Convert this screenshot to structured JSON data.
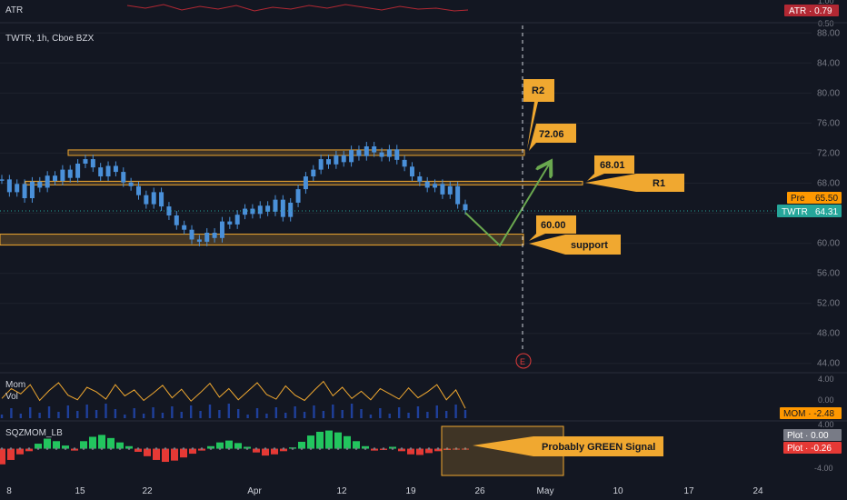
{
  "header": {
    "symbol_label": "TWTR, 1h, Cboe BZX",
    "atr_label": "ATR"
  },
  "badges": {
    "atr": "ATR · 0.79",
    "pre": "Pre",
    "pre_value": "65.50",
    "ticker": "TWTR",
    "ticker_value": "64.31",
    "mom": "MOM · -2.48",
    "plot1": "Plot · 0.00",
    "plot2": "Plot · -0.26"
  },
  "annotations": {
    "r2": "R2",
    "r2_value": "72.06",
    "r1": "R1",
    "r1_value": "68.01",
    "support": "support",
    "support_value": "60.00",
    "signal": "Probably GREEN Signal",
    "event_marker": "E"
  },
  "indicators": {
    "mom_label": "Mom",
    "vol_label": "Vol",
    "sqz_label": "SQZMOM_LB"
  },
  "colors": {
    "background": "#131722",
    "candle": "#4a90d9",
    "zone": "#f0a830",
    "arrow": "#6aa84f",
    "ticker_badge": "#26a69a",
    "pre_badge": "#ff9800",
    "atr_badge": "#b22833"
  },
  "chart_data": [
    {
      "type": "line",
      "name": "price",
      "x": [
        "8",
        "15",
        "22",
        "Apr",
        "12",
        "19",
        "26",
        "May",
        "10",
        "17",
        "24"
      ],
      "ylim": [
        43,
        89
      ],
      "yticks": [
        44.0,
        48.0,
        52.0,
        56.0,
        60.0,
        64.0,
        68.0,
        72.0,
        76.0,
        80.0,
        84.0,
        88.0
      ],
      "ytick_labels": [
        "44.00",
        "48.00",
        "52.00",
        "56.00",
        "60.00",
        "64.00",
        "68.00",
        "72.00",
        "76.00",
        "80.00",
        "84.00",
        "88.00"
      ],
      "levels": [
        {
          "label": "R2",
          "value": 72.06
        },
        {
          "label": "R1",
          "value": 68.01
        },
        {
          "label": "support",
          "value": 60.0
        }
      ],
      "series": [
        {
          "values": [
            68.5,
            66.8,
            67.9,
            66.0,
            68.2,
            67.4,
            69.0,
            68.3,
            69.8,
            68.7,
            70.6,
            71.2,
            70.1,
            68.9,
            70.3,
            69.5,
            68.1,
            67.6,
            66.4,
            65.2,
            66.8,
            64.9,
            63.7,
            62.4,
            61.8,
            60.5,
            60.2,
            61.4,
            60.7,
            62.9,
            62.5,
            63.8,
            64.6,
            63.9,
            65.0,
            64.2,
            65.8,
            63.5,
            65.4,
            67.2,
            68.9,
            69.8,
            71.2,
            70.5,
            71.7,
            70.8,
            72.4,
            71.6,
            72.9,
            72.1,
            71.5,
            72.5,
            71.1,
            70.2,
            68.9,
            68.2,
            67.4,
            67.9,
            66.5,
            67.6,
            65.2,
            64.4
          ]
        }
      ]
    },
    {
      "type": "line",
      "name": "mom",
      "ylim": [
        -2.5,
        4.0
      ],
      "yticks": [
        4.0,
        0.0
      ],
      "ytick_labels": [
        "4.00",
        "0.00"
      ],
      "series": [
        {
          "values": [
            0.5,
            2.0,
            1.2,
            2.6,
            0.2,
            1.7,
            2.9,
            1.0,
            0.3,
            2.2,
            1.5,
            0.4,
            2.6,
            0.9,
            1.8,
            0.2,
            1.3,
            2.5,
            0.6,
            1.9,
            0.1,
            1.4,
            2.8,
            0.7,
            2.0,
            0.3,
            1.6,
            2.9,
            1.1,
            0.4,
            2.4,
            1.0,
            0.2,
            1.7,
            3.1,
            0.9,
            2.2,
            0.5,
            1.6,
            0.3,
            2.0,
            1.2,
            0.4,
            2.1,
            0.6,
            1.5,
            2.6,
            0.3,
            1.8,
            -1.0
          ]
        }
      ]
    },
    {
      "type": "bar",
      "name": "sqzmom",
      "ylim": [
        -5.0,
        4.0
      ],
      "yticks": [
        4.0,
        -4.0
      ],
      "ytick_labels": [
        "4.00",
        "-4.00"
      ],
      "series": [
        {
          "values": [
            -2.5,
            -1.8,
            -0.9,
            -0.4,
            0.8,
            1.6,
            1.2,
            0.5,
            -0.3,
            1.2,
            1.9,
            2.2,
            1.7,
            1.0,
            0.4,
            -0.5,
            -1.2,
            -1.8,
            -2.1,
            -1.9,
            -1.4,
            -0.8,
            -0.3,
            0.4,
            1.0,
            1.3,
            0.9,
            0.3,
            -0.6,
            -1.1,
            -0.9,
            -0.4,
            0.2,
            1.1,
            2.1,
            2.7,
            2.9,
            2.6,
            2.0,
            1.2,
            0.4,
            -0.3,
            -0.2,
            0.3,
            -0.4,
            -0.9,
            -1.0,
            -0.7,
            -0.4,
            -0.2,
            -0.1,
            -0.05
          ]
        }
      ]
    }
  ],
  "x_axis": {
    "labels": [
      "8",
      "15",
      "22",
      "Apr",
      "12",
      "19",
      "26",
      "May",
      "10",
      "17",
      "24"
    ]
  }
}
